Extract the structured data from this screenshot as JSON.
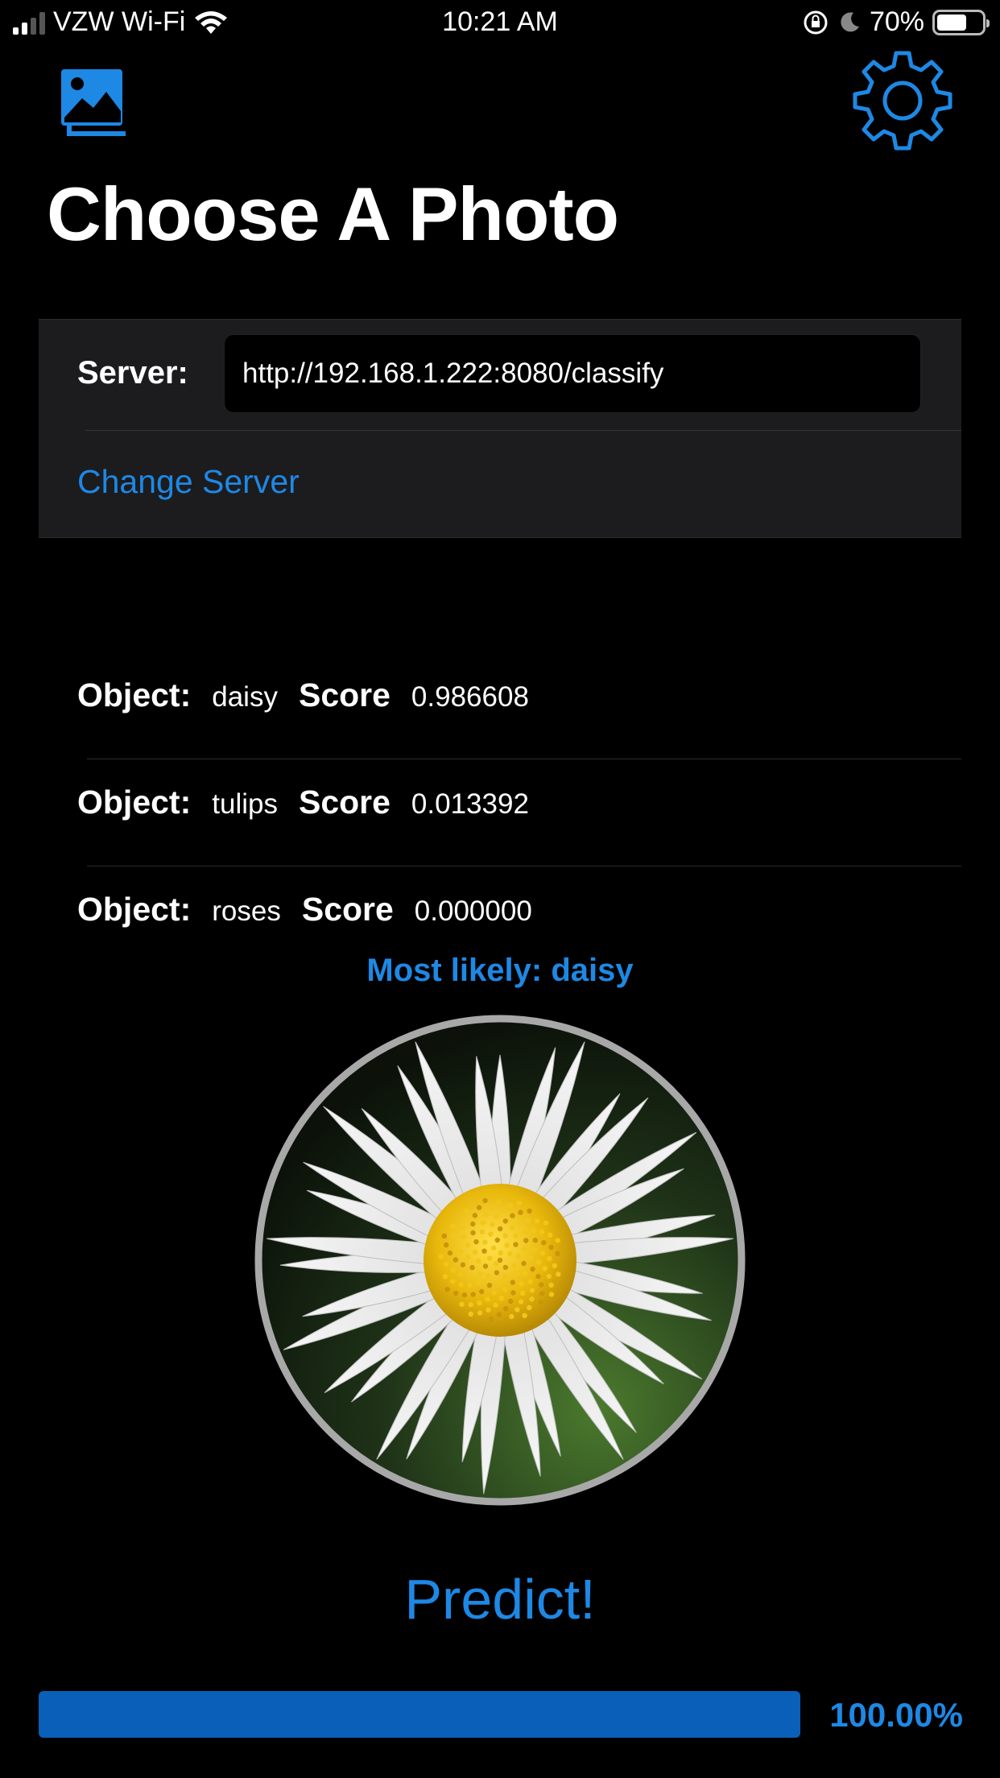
{
  "status_bar": {
    "carrier": "VZW Wi-Fi",
    "time": "10:21 AM",
    "battery_text": "70%",
    "battery_level": 0.7
  },
  "header": {
    "title": "Choose A Photo",
    "gallery_icon": "photo-gallery-icon",
    "settings_icon": "gear-icon"
  },
  "server": {
    "label": "Server:",
    "value": "http://192.168.1.222:8080/classify",
    "change_label": "Change Server"
  },
  "results": [
    {
      "object_label": "Object:",
      "object": "daisy",
      "score_label": "Score",
      "score": "0.986608"
    },
    {
      "object_label": "Object:",
      "object": "tulips",
      "score_label": "Score",
      "score": "0.013392"
    },
    {
      "object_label": "Object:",
      "object": "roses",
      "score_label": "Score",
      "score": "0.000000"
    }
  ],
  "most_likely": "Most likely: daisy",
  "predict_label": "Predict!",
  "progress": {
    "value": 1.0,
    "text": "100.00%"
  },
  "colors": {
    "accent": "#1e88e5",
    "progress_fill": "#0a5fb8",
    "background": "#000000",
    "card": "#1c1c1e"
  }
}
